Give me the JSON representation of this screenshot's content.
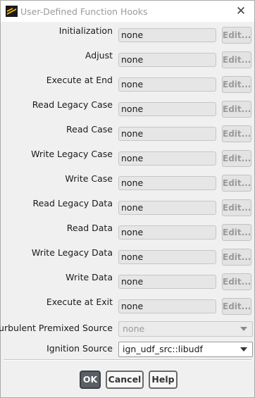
{
  "window": {
    "title": "User-Defined Function Hooks",
    "close_symbol": "✕",
    "icon": "ansys-fluent-icon",
    "accent_colors": {
      "icon_black": "#1a1a1a",
      "icon_yellow": "#f5b800",
      "ok_button": "#5a5f66"
    }
  },
  "hooks": [
    {
      "label": "Initialization",
      "value": "none",
      "edit_label": "Edit..."
    },
    {
      "label": "Adjust",
      "value": "none",
      "edit_label": "Edit..."
    },
    {
      "label": "Execute at End",
      "value": "none",
      "edit_label": "Edit..."
    },
    {
      "label": "Read Legacy Case",
      "value": "none",
      "edit_label": "Edit..."
    },
    {
      "label": "Read Case",
      "value": "none",
      "edit_label": "Edit..."
    },
    {
      "label": "Write Legacy Case",
      "value": "none",
      "edit_label": "Edit..."
    },
    {
      "label": "Write Case",
      "value": "none",
      "edit_label": "Edit..."
    },
    {
      "label": "Read Legacy Data",
      "value": "none",
      "edit_label": "Edit..."
    },
    {
      "label": "Read Data",
      "value": "none",
      "edit_label": "Edit..."
    },
    {
      "label": "Write Legacy Data",
      "value": "none",
      "edit_label": "Edit..."
    },
    {
      "label": "Write Data",
      "value": "none",
      "edit_label": "Edit..."
    },
    {
      "label": "Execute at Exit",
      "value": "none",
      "edit_label": "Edit..."
    }
  ],
  "turbulent_premixed_source": {
    "label": "Turbulent Premixed Source",
    "value": "none"
  },
  "ignition_source": {
    "label": "Ignition Source",
    "value": "ign_udf_src::libudf"
  },
  "buttons": {
    "ok": "OK",
    "cancel": "Cancel",
    "help": "Help"
  }
}
